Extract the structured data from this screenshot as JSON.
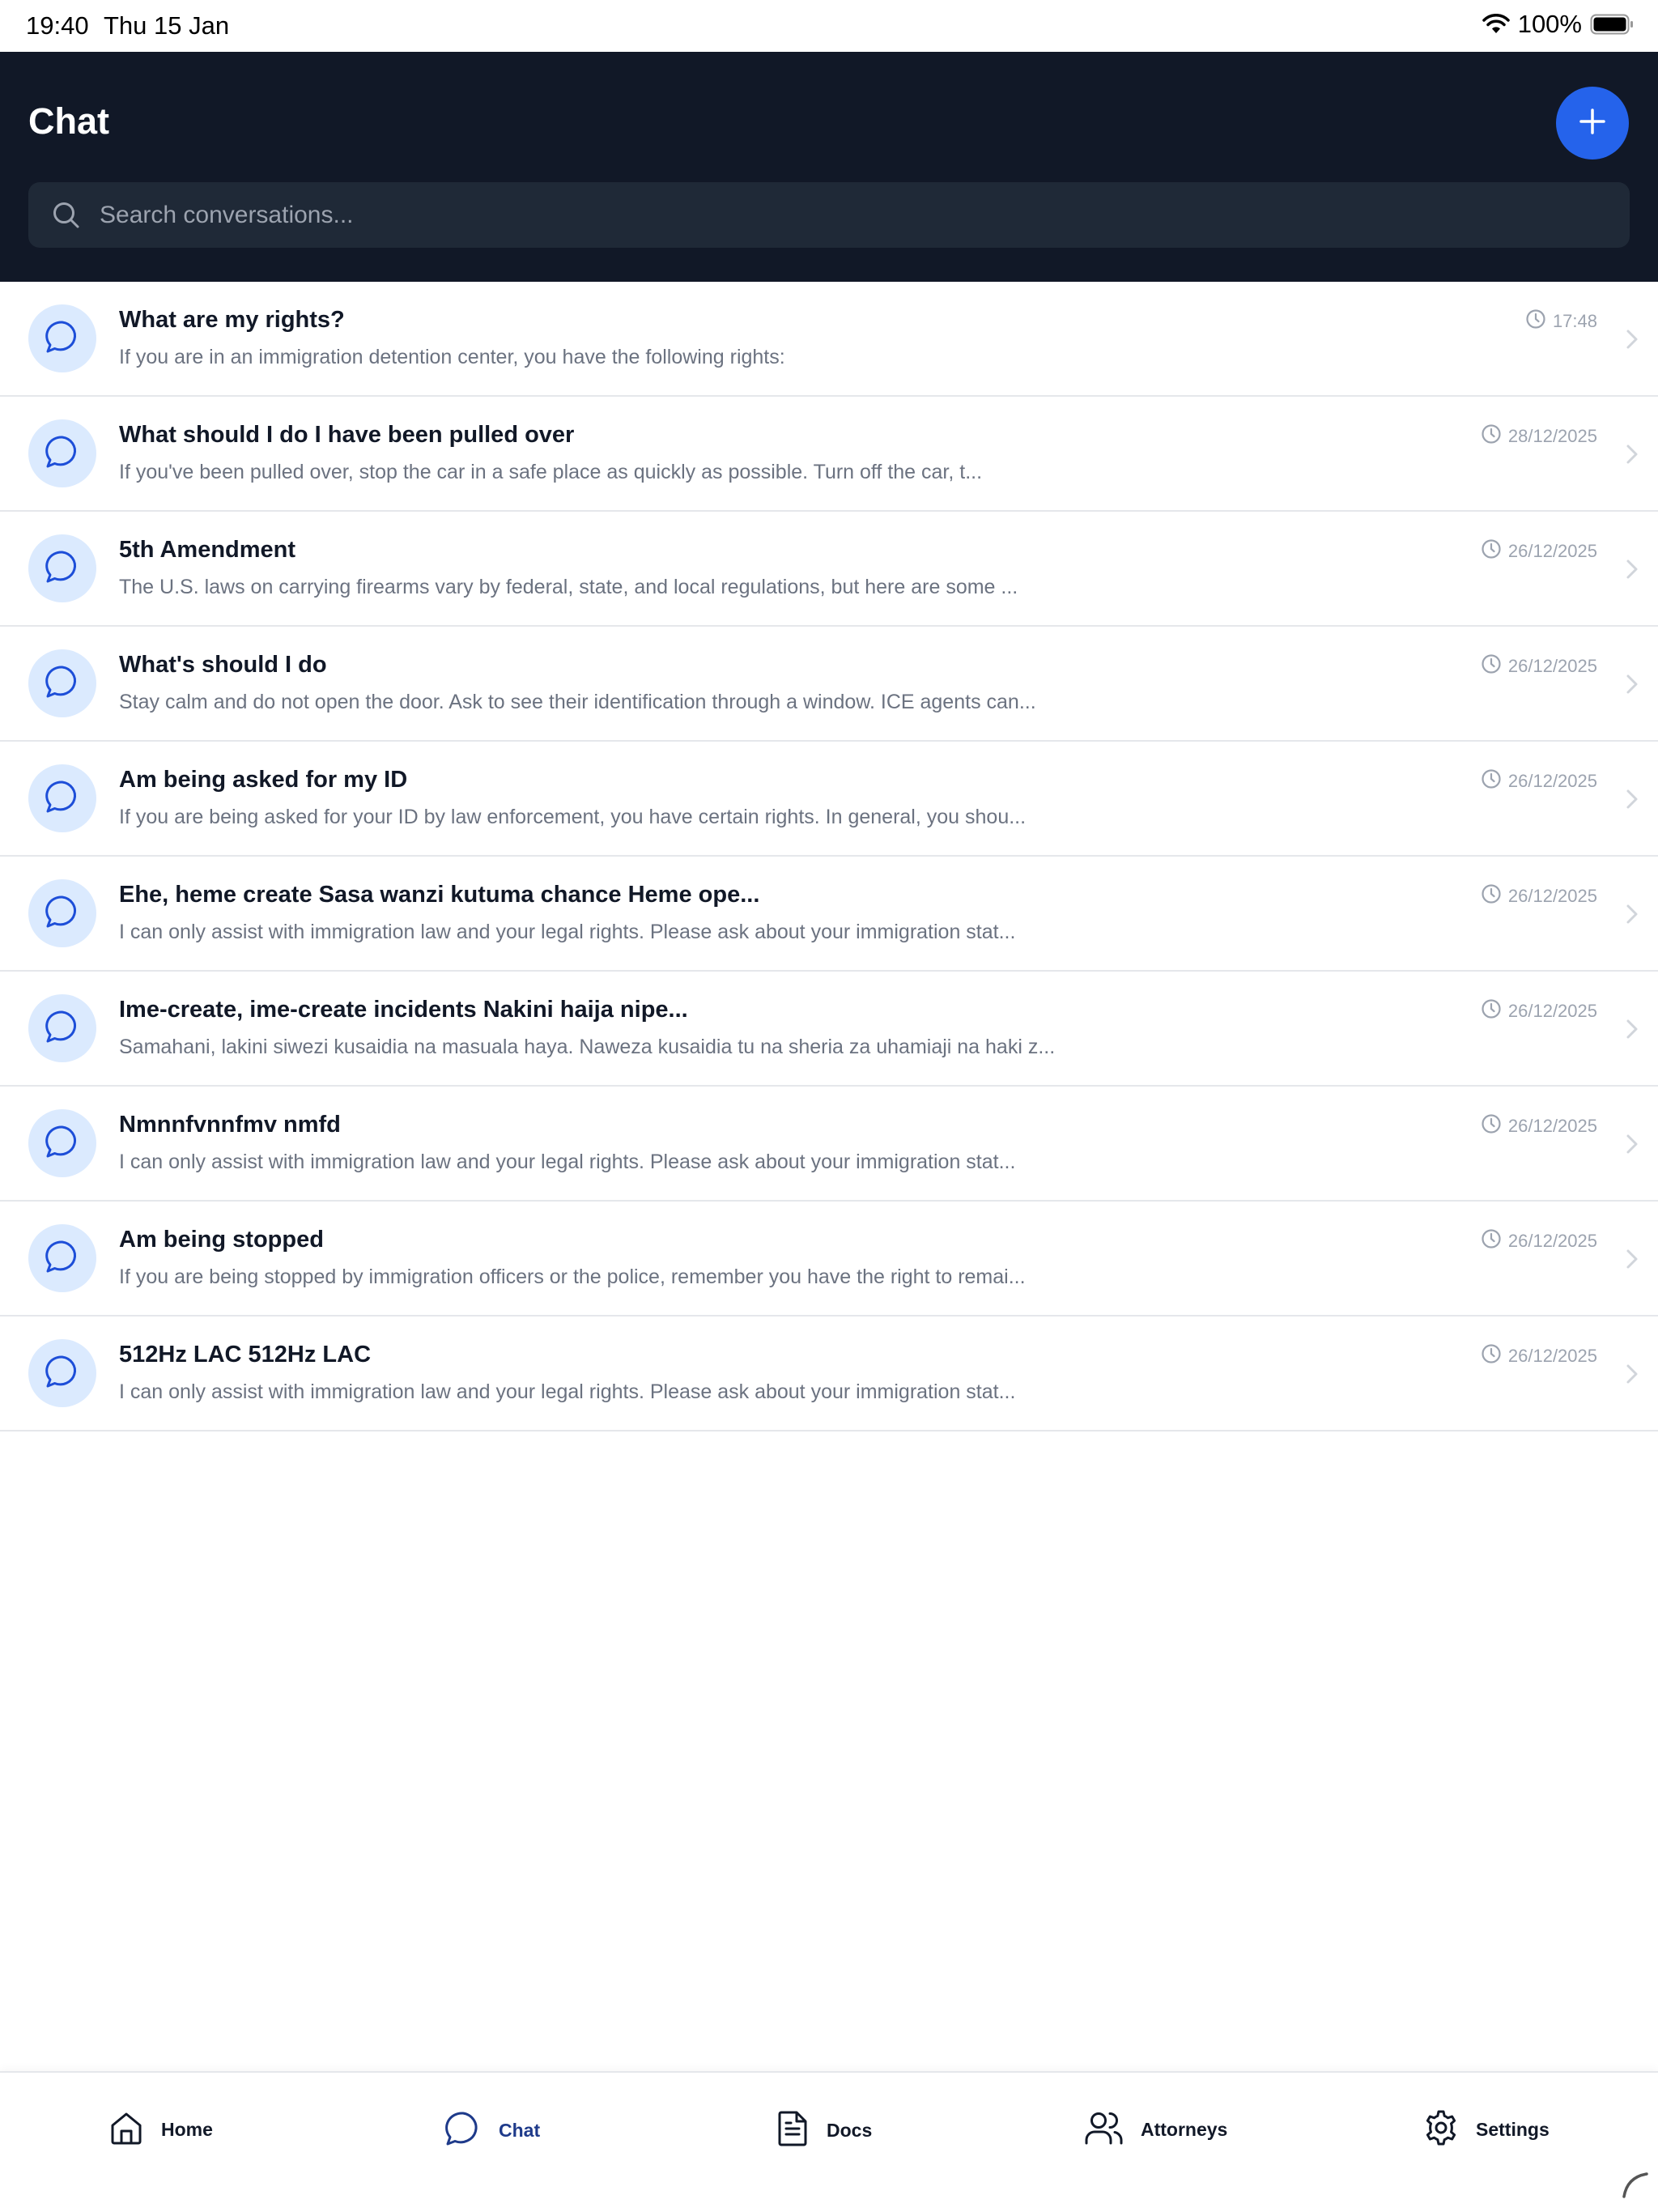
{
  "status_bar": {
    "time": "19:40",
    "date": "Thu 15 Jan",
    "battery": "100%"
  },
  "header": {
    "title": "Chat",
    "new_button_icon": "plus-icon"
  },
  "search": {
    "placeholder": "Search conversations..."
  },
  "conversations": [
    {
      "title": "What are my rights?",
      "preview": "If you are in an immigration detention center, you have the following rights:",
      "time": "17:48"
    },
    {
      "title": "What should I do I have been pulled over",
      "preview": "If you've been pulled over, stop the car in a safe place as quickly as possible. Turn off the car, t...",
      "time": "28/12/2025"
    },
    {
      "title": "5th Amendment",
      "preview": "The U.S. laws on carrying firearms vary by federal, state, and local regulations, but here are some ...",
      "time": "26/12/2025"
    },
    {
      "title": "What's should I do",
      "preview": "Stay calm and do not open the door. Ask to see their identification through a window. ICE agents can...",
      "time": "26/12/2025"
    },
    {
      "title": "Am being asked for my ID",
      "preview": "If you are being asked for your ID by law enforcement, you have certain rights. In general, you shou...",
      "time": "26/12/2025"
    },
    {
      "title": "Ehe, heme create Sasa wanzi kutuma chance Heme ope...",
      "preview": "I can only assist with immigration law and your legal rights. Please ask about your immigration stat...",
      "time": "26/12/2025"
    },
    {
      "title": "Ime-create, ime-create incidents Nakini haija nipe...",
      "preview": "Samahani, lakini siwezi kusaidia na masuala haya. Naweza kusaidia tu na sheria za uhamiaji na haki z...",
      "time": "26/12/2025"
    },
    {
      "title": "Nmnnfvnnfmv nmfd",
      "preview": "I can only assist with immigration law and your legal rights. Please ask about your immigration stat...",
      "time": "26/12/2025"
    },
    {
      "title": "Am being stopped",
      "preview": "If you are being stopped by immigration officers or the police, remember you have the right to remai...",
      "time": "26/12/2025"
    },
    {
      "title": "512Hz LAC 512Hz LAC",
      "preview": "I can only assist with immigration law and your legal rights. Please ask about your immigration stat...",
      "time": "26/12/2025"
    }
  ],
  "tabs": [
    {
      "label": "Home",
      "icon": "home-icon"
    },
    {
      "label": "Chat",
      "icon": "chat-bubble-icon",
      "active": true
    },
    {
      "label": "Docs",
      "icon": "document-icon"
    },
    {
      "label": "Attorneys",
      "icon": "users-icon"
    },
    {
      "label": "Settings",
      "icon": "gear-icon"
    }
  ],
  "colors": {
    "header_bg": "#111827",
    "accent": "#2563eb",
    "avatar_bg": "#dbeafe",
    "active_tab": "#1e3a8a"
  }
}
